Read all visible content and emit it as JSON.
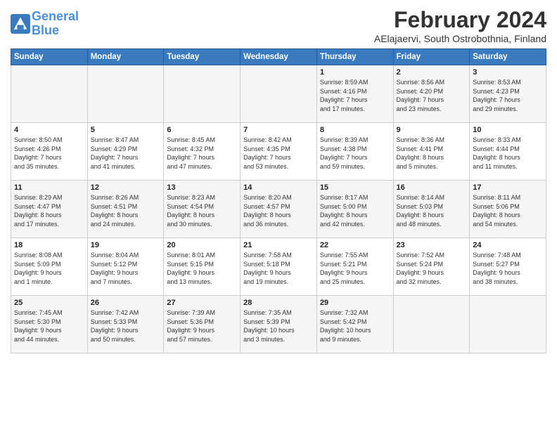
{
  "logo": {
    "line1": "General",
    "line2": "Blue"
  },
  "title": "February 2024",
  "location": "AElajaervi, South Ostrobothnia, Finland",
  "days_header": [
    "Sunday",
    "Monday",
    "Tuesday",
    "Wednesday",
    "Thursday",
    "Friday",
    "Saturday"
  ],
  "weeks": [
    [
      {
        "day": "",
        "info": ""
      },
      {
        "day": "",
        "info": ""
      },
      {
        "day": "",
        "info": ""
      },
      {
        "day": "",
        "info": ""
      },
      {
        "day": "1",
        "info": "Sunrise: 8:59 AM\nSunset: 4:16 PM\nDaylight: 7 hours\nand 17 minutes."
      },
      {
        "day": "2",
        "info": "Sunrise: 8:56 AM\nSunset: 4:20 PM\nDaylight: 7 hours\nand 23 minutes."
      },
      {
        "day": "3",
        "info": "Sunrise: 8:53 AM\nSunset: 4:23 PM\nDaylight: 7 hours\nand 29 minutes."
      }
    ],
    [
      {
        "day": "4",
        "info": "Sunrise: 8:50 AM\nSunset: 4:26 PM\nDaylight: 7 hours\nand 35 minutes."
      },
      {
        "day": "5",
        "info": "Sunrise: 8:47 AM\nSunset: 4:29 PM\nDaylight: 7 hours\nand 41 minutes."
      },
      {
        "day": "6",
        "info": "Sunrise: 8:45 AM\nSunset: 4:32 PM\nDaylight: 7 hours\nand 47 minutes."
      },
      {
        "day": "7",
        "info": "Sunrise: 8:42 AM\nSunset: 4:35 PM\nDaylight: 7 hours\nand 53 minutes."
      },
      {
        "day": "8",
        "info": "Sunrise: 8:39 AM\nSunset: 4:38 PM\nDaylight: 7 hours\nand 59 minutes."
      },
      {
        "day": "9",
        "info": "Sunrise: 8:36 AM\nSunset: 4:41 PM\nDaylight: 8 hours\nand 5 minutes."
      },
      {
        "day": "10",
        "info": "Sunrise: 8:33 AM\nSunset: 4:44 PM\nDaylight: 8 hours\nand 11 minutes."
      }
    ],
    [
      {
        "day": "11",
        "info": "Sunrise: 8:29 AM\nSunset: 4:47 PM\nDaylight: 8 hours\nand 17 minutes."
      },
      {
        "day": "12",
        "info": "Sunrise: 8:26 AM\nSunset: 4:51 PM\nDaylight: 8 hours\nand 24 minutes."
      },
      {
        "day": "13",
        "info": "Sunrise: 8:23 AM\nSunset: 4:54 PM\nDaylight: 8 hours\nand 30 minutes."
      },
      {
        "day": "14",
        "info": "Sunrise: 8:20 AM\nSunset: 4:57 PM\nDaylight: 8 hours\nand 36 minutes."
      },
      {
        "day": "15",
        "info": "Sunrise: 8:17 AM\nSunset: 5:00 PM\nDaylight: 8 hours\nand 42 minutes."
      },
      {
        "day": "16",
        "info": "Sunrise: 8:14 AM\nSunset: 5:03 PM\nDaylight: 8 hours\nand 48 minutes."
      },
      {
        "day": "17",
        "info": "Sunrise: 8:11 AM\nSunset: 5:06 PM\nDaylight: 8 hours\nand 54 minutes."
      }
    ],
    [
      {
        "day": "18",
        "info": "Sunrise: 8:08 AM\nSunset: 5:09 PM\nDaylight: 9 hours\nand 1 minute."
      },
      {
        "day": "19",
        "info": "Sunrise: 8:04 AM\nSunset: 5:12 PM\nDaylight: 9 hours\nand 7 minutes."
      },
      {
        "day": "20",
        "info": "Sunrise: 8:01 AM\nSunset: 5:15 PM\nDaylight: 9 hours\nand 13 minutes."
      },
      {
        "day": "21",
        "info": "Sunrise: 7:58 AM\nSunset: 5:18 PM\nDaylight: 9 hours\nand 19 minutes."
      },
      {
        "day": "22",
        "info": "Sunrise: 7:55 AM\nSunset: 5:21 PM\nDaylight: 9 hours\nand 25 minutes."
      },
      {
        "day": "23",
        "info": "Sunrise: 7:52 AM\nSunset: 5:24 PM\nDaylight: 9 hours\nand 32 minutes."
      },
      {
        "day": "24",
        "info": "Sunrise: 7:48 AM\nSunset: 5:27 PM\nDaylight: 9 hours\nand 38 minutes."
      }
    ],
    [
      {
        "day": "25",
        "info": "Sunrise: 7:45 AM\nSunset: 5:30 PM\nDaylight: 9 hours\nand 44 minutes."
      },
      {
        "day": "26",
        "info": "Sunrise: 7:42 AM\nSunset: 5:33 PM\nDaylight: 9 hours\nand 50 minutes."
      },
      {
        "day": "27",
        "info": "Sunrise: 7:39 AM\nSunset: 5:36 PM\nDaylight: 9 hours\nand 57 minutes."
      },
      {
        "day": "28",
        "info": "Sunrise: 7:35 AM\nSunset: 5:39 PM\nDaylight: 10 hours\nand 3 minutes."
      },
      {
        "day": "29",
        "info": "Sunrise: 7:32 AM\nSunset: 5:42 PM\nDaylight: 10 hours\nand 9 minutes."
      },
      {
        "day": "",
        "info": ""
      },
      {
        "day": "",
        "info": ""
      }
    ]
  ]
}
